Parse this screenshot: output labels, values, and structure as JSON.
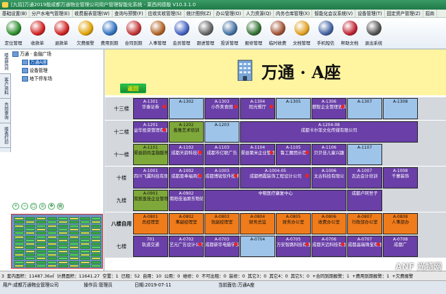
{
  "title_bar": {
    "text": "[九招]万通2019版成都万通物业管理公司用户管理智能化系统 - 莱西闲德版 V10.3.1.0"
  },
  "menu": [
    "基础设置(B)",
    "分户水电气管理(E)",
    "收费报表管理(W)",
    "查询与预警(F)",
    "应收实收管理(S)",
    "统计图例(Z)",
    "办公管理(O)",
    "人力资源(Q)",
    "内务仓库管理(X)",
    "智能化会议系统(V)",
    "设备管理(T)",
    "固定资产管理(Z)",
    "招商"
  ],
  "toolbar": [
    {
      "label": "定位管理",
      "icon": "locate-icon",
      "color": "#2a8a2a"
    },
    {
      "label": "收款单",
      "icon": "receipt-icon",
      "color": "#d02020"
    },
    {
      "label": "退款单",
      "icon": "refund-icon",
      "color": "#d02020"
    },
    {
      "label": "欠费报警",
      "icon": "bell-icon",
      "color": "#e0a000"
    },
    {
      "label": "费用到期",
      "icon": "clock-icon",
      "color": "#3070c0"
    },
    {
      "label": "合同到期",
      "icon": "alarm-icon",
      "color": "#c03030"
    },
    {
      "label": "人事管理",
      "icon": "person-icon",
      "color": "#b06020"
    },
    {
      "label": "会员管理",
      "icon": "member-icon",
      "color": "#4060c0"
    },
    {
      "label": "跟进管理",
      "icon": "follow-icon",
      "color": "#606060"
    },
    {
      "label": "投诉管理",
      "icon": "complaint-icon",
      "color": "#4070a0"
    },
    {
      "label": "报修管理",
      "icon": "repair-icon",
      "color": "#307030"
    },
    {
      "label": "临时收费",
      "icon": "cash-icon",
      "color": "#a05030"
    },
    {
      "label": "文档管理",
      "icon": "folder-icon",
      "color": "#e0a020"
    },
    {
      "label": "手机短信",
      "icon": "phone-icon",
      "color": "#4060a0"
    },
    {
      "label": "帮助文档",
      "icon": "help-icon",
      "color": "#c02030"
    },
    {
      "label": "退出系统",
      "icon": "exit-icon",
      "color": "#505050"
    }
  ],
  "side_tabs": [
    "楼盘房间",
    "客户资料",
    "合同查询",
    "报表打印"
  ],
  "tree": {
    "root": "万通 · 金融广场",
    "children": [
      "万通A座",
      "设备管理",
      "地下停车场"
    ]
  },
  "building": {
    "title": "万通 · A座",
    "back_label": "返回"
  },
  "floors": [
    {
      "label": "十三楼",
      "units": [
        {
          "no": "A-1301",
          "name": "华泰证券",
          "style": "purple",
          "flag": true
        },
        {
          "no": "A-1302",
          "name": "",
          "style": "blue"
        },
        {
          "no": "A-1303",
          "name": "小乔美食园",
          "style": "purple",
          "flag": true
        },
        {
          "no": "A-1304",
          "name": "阳光餐厅",
          "style": "purple",
          "flag": true
        },
        {
          "no": "A-1305",
          "name": "",
          "style": "blue"
        },
        {
          "no": "A-1306",
          "name": "麒智企业管理咨询",
          "style": "purple",
          "flag": true
        },
        {
          "no": "A-1307",
          "name": "",
          "style": "blue"
        },
        {
          "no": "A-1308",
          "name": "",
          "style": "blue"
        }
      ]
    },
    {
      "label": "十二楼",
      "units": [
        {
          "no": "A-1201",
          "name": "益华投资管理有限",
          "style": "purple",
          "flag": true
        },
        {
          "no": "A-1202",
          "name": "善雅艺术培训",
          "style": "olive"
        },
        {
          "no": "A-1203",
          "name": "",
          "style": "blue"
        },
        {
          "no": "A-1204-08",
          "name": "成都卡尔菲文化传媒有限公司",
          "style": "wide"
        }
      ]
    },
    {
      "label": "十一楼",
      "units": [
        {
          "no": "A-1101",
          "name": "渠县韵尚金融服务有限公司",
          "style": "olive"
        },
        {
          "no": "A-1102",
          "name": "成都天韵科技有",
          "style": "purple",
          "flag": true
        },
        {
          "no": "A-1103",
          "name": "成都市亿联广告",
          "style": "purple"
        },
        {
          "no": "A-1104",
          "name": "渠县聚米企业管理有限公司",
          "style": "purple",
          "flag": true
        },
        {
          "no": "A-1105",
          "name": "鲁工魔团示范",
          "style": "purple",
          "flag": true
        },
        {
          "no": "A-1106",
          "name": "贝贝佳儿童兴趣",
          "style": "purple"
        },
        {
          "no": "A-1107",
          "name": "",
          "style": "blue"
        }
      ]
    },
    {
      "label": "十楼",
      "units": [
        {
          "no": "A-1001",
          "name": "四川飞翼科技有限",
          "style": "purple"
        },
        {
          "no": "A-1002",
          "name": "成都恩奉福商务",
          "style": "purple",
          "flag": true
        },
        {
          "no": "A-1003",
          "name": "成都博锐软件技术有限公司",
          "style": "purple",
          "flag": true
        },
        {
          "no": "A-1004-05",
          "name": "成都栖霞装饰工程设计公司",
          "style": "purple",
          "flag": true
        },
        {
          "no": "A-1006",
          "name": "太古科技有限公",
          "style": "purple"
        },
        {
          "no": "A-1007",
          "name": "志达会计培训",
          "style": "purple"
        },
        {
          "no": "A-1008",
          "name": "千寨装饰",
          "style": "purple"
        }
      ]
    },
    {
      "label": "九楼",
      "units": [
        {
          "no": "A-0901",
          "name": "双辰盖佳企业管理有限公司",
          "style": "olive"
        },
        {
          "no": "A-0902",
          "name": "南阳佳油原东物处",
          "style": "purple"
        },
        {
          "no": "",
          "name": "中租医疗康复中心",
          "style": "wide"
        },
        {
          "no": "",
          "name": "成都卢珂世子",
          "style": "purple"
        }
      ]
    },
    {
      "label": "八楼自用",
      "units": [
        {
          "no": "A-0801",
          "name": "总经理室",
          "style": "orange"
        },
        {
          "no": "A-0802",
          "name": "事副经理室",
          "style": "orange"
        },
        {
          "no": "A-0803",
          "name": "张副经理室",
          "style": "orange"
        },
        {
          "no": "A-0804",
          "name": "财务总监",
          "style": "orange"
        },
        {
          "no": "A-0805",
          "name": "财务办公室",
          "style": "orange"
        },
        {
          "no": "A-0806",
          "name": "收费办公室",
          "style": "orange"
        },
        {
          "no": "A-0807",
          "name": "行政部办公室",
          "style": "orange"
        },
        {
          "no": "A-0808",
          "name": "人事部办",
          "style": "orange"
        }
      ]
    },
    {
      "label": "七楼",
      "units": [
        {
          "no": "701",
          "name": "轨道交通",
          "style": "purple"
        },
        {
          "no": "A-0702",
          "name": "艺元广告设计公司",
          "style": "purple",
          "flag": true
        },
        {
          "no": "A-0703",
          "name": "成都新华电脑学校",
          "style": "purple",
          "flag": true
        },
        {
          "no": "A-0704",
          "name": "",
          "style": "blue"
        },
        {
          "no": "A-0705",
          "name": "万安智路科技有限公司",
          "style": "purple",
          "flag": true
        },
        {
          "no": "A-0706",
          "name": "成都天迈科技有限公司",
          "style": "purple",
          "flag": true
        },
        {
          "no": "A-0707",
          "name": "成都晶瑞珠宝有限公司",
          "style": "purple",
          "flag": true
        },
        {
          "no": "A-0708",
          "name": "成都广",
          "style": "purple"
        }
      ]
    }
  ],
  "status": [
    "3",
    "套内面积：11487.36㎡",
    "计费面积：11641.27",
    "空置：1",
    "已租：52",
    "自用：10",
    "公用：0",
    "维修：0",
    "不可出租：0",
    "装修：0",
    "其它3：0",
    "其它4：0",
    "其它5：0",
    "+合同到期报警：1",
    "+费用到期报警：1",
    "+欠费报警"
  ],
  "footer": {
    "user": "用户:成都万通物业管理公司",
    "operator": "操作员:管理员",
    "date": "日期:2019-07-11",
    "current": "当前面信:万通A座"
  },
  "watermark": "ANF 光特网"
}
